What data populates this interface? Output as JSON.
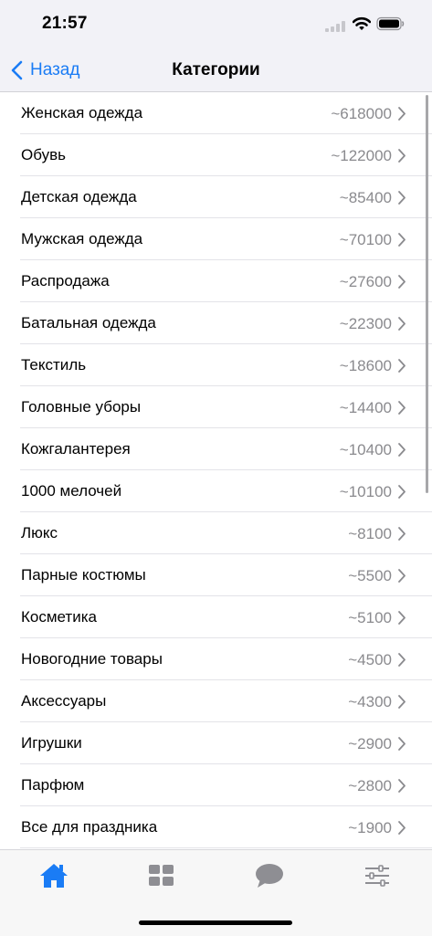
{
  "status_bar": {
    "time": "21:57"
  },
  "nav": {
    "back_label": "Назад",
    "title": "Категории"
  },
  "categories": [
    {
      "label": "Женская одежда",
      "count": "~618000"
    },
    {
      "label": "Обувь",
      "count": "~122000"
    },
    {
      "label": "Детская одежда",
      "count": "~85400"
    },
    {
      "label": "Мужская одежда",
      "count": "~70100"
    },
    {
      "label": "Распродажа",
      "count": "~27600"
    },
    {
      "label": "Батальная одежда",
      "count": "~22300"
    },
    {
      "label": "Текстиль",
      "count": "~18600"
    },
    {
      "label": "Головные уборы",
      "count": "~14400"
    },
    {
      "label": "Кожгалантерея",
      "count": "~10400"
    },
    {
      "label": "1000 мелочей",
      "count": "~10100"
    },
    {
      "label": "Люкс",
      "count": "~8100"
    },
    {
      "label": "Парные костюмы",
      "count": "~5500"
    },
    {
      "label": "Косметика",
      "count": "~5100"
    },
    {
      "label": "Новогодние товары",
      "count": "~4500"
    },
    {
      "label": "Аксессуары",
      "count": "~4300"
    },
    {
      "label": "Игрушки",
      "count": "~2900"
    },
    {
      "label": "Парфюм",
      "count": "~2800"
    },
    {
      "label": "Все для праздника",
      "count": "~1900"
    }
  ],
  "tabs": [
    {
      "icon": "home-icon",
      "active": true
    },
    {
      "icon": "grid-icon",
      "active": false
    },
    {
      "icon": "chat-icon",
      "active": false
    },
    {
      "icon": "sliders-icon",
      "active": false
    }
  ],
  "colors": {
    "accent": "#1a7cf5",
    "inactive_icon": "#8e8e93",
    "secondary_text": "#8a8a8e"
  }
}
